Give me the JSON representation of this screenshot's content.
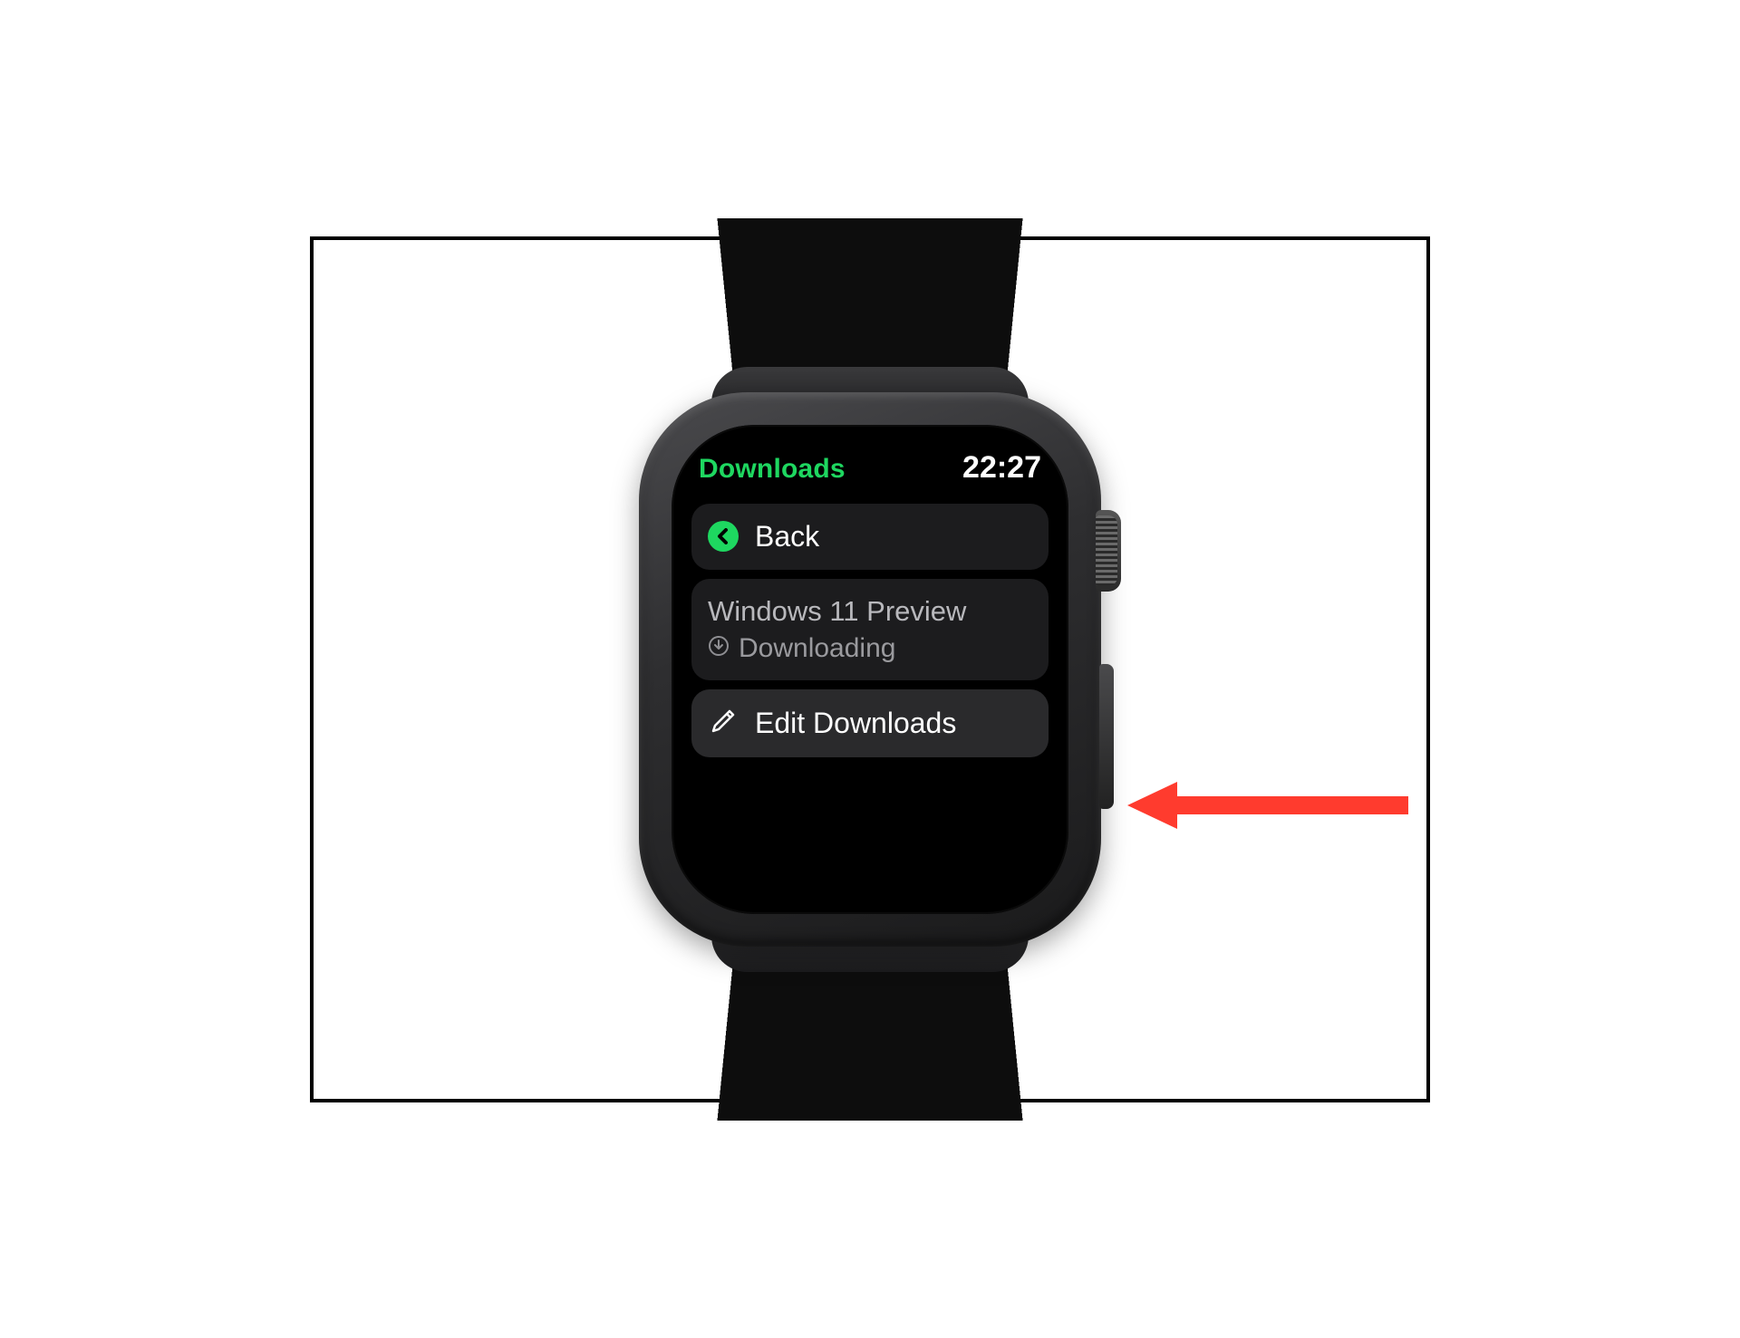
{
  "header": {
    "title": "Downloads",
    "time": "22:27"
  },
  "rows": {
    "back": {
      "label": "Back"
    },
    "download_item": {
      "title": "Windows 11 Preview",
      "status": "Downloading"
    },
    "edit": {
      "label": "Edit Downloads"
    }
  },
  "colors": {
    "accent": "#1ED760",
    "row_bg": "#1c1c1e",
    "annotation": "#FF3B2E"
  }
}
